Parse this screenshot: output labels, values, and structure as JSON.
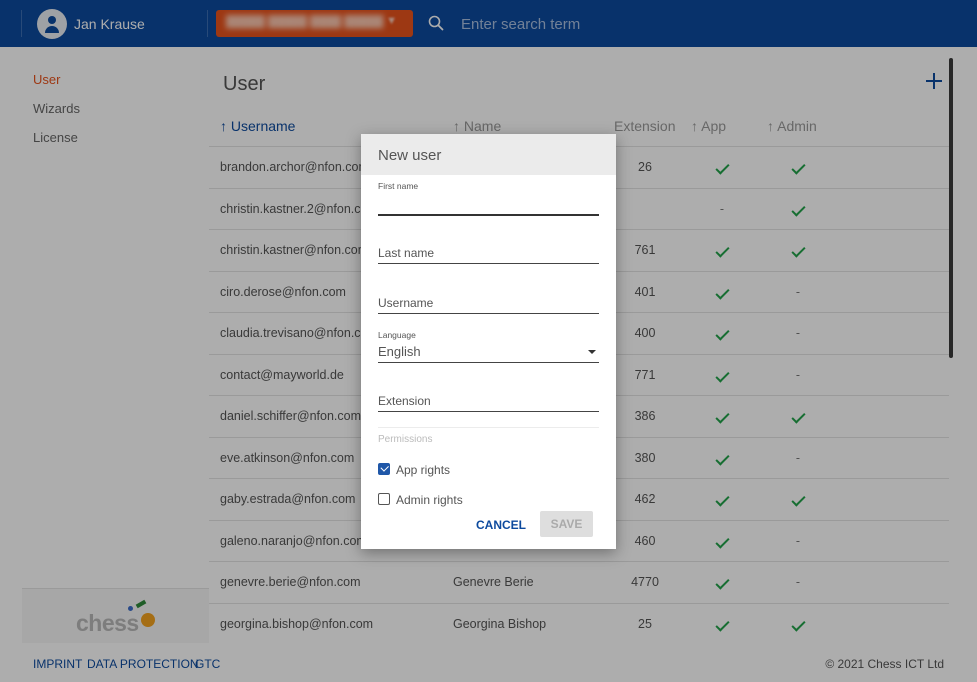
{
  "header": {
    "user_name": "Jan Krause",
    "account_selector": "█████ █████ ████ █████",
    "search_placeholder": "Enter search term",
    "icons": [
      "avatar-icon",
      "search-icon",
      "chevron-down-icon"
    ]
  },
  "sidebar": {
    "items": [
      {
        "label": "User",
        "active": true
      },
      {
        "label": "Wizards",
        "active": false
      },
      {
        "label": "License",
        "active": false
      }
    ],
    "logo_text": "chess"
  },
  "main": {
    "title": "User",
    "add_icon": "plus-icon",
    "columns": {
      "username": "↑ Username",
      "name": "↑ Name",
      "extension": "Extension",
      "app": "↑ App",
      "admin": "↑ Admin"
    },
    "rows": [
      {
        "username": "brandon.archor@nfon.com",
        "name": "",
        "extension": "26",
        "app": true,
        "admin": true
      },
      {
        "username": "christin.kastner.2@nfon.com",
        "name": "",
        "extension": "",
        "app": false,
        "admin": true
      },
      {
        "username": "christin.kastner@nfon.com",
        "name": "",
        "extension": "761",
        "app": true,
        "admin": true
      },
      {
        "username": "ciro.derose@nfon.com",
        "name": "",
        "extension": "401",
        "app": true,
        "admin": false
      },
      {
        "username": "claudia.trevisano@nfon.com",
        "name": "",
        "extension": "400",
        "app": true,
        "admin": false
      },
      {
        "username": "contact@mayworld.de",
        "name": "",
        "extension": "771",
        "app": true,
        "admin": false
      },
      {
        "username": "daniel.schiffer@nfon.com",
        "name": "",
        "extension": "386",
        "app": true,
        "admin": true
      },
      {
        "username": "eve.atkinson@nfon.com",
        "name": "",
        "extension": "380",
        "app": true,
        "admin": false
      },
      {
        "username": "gaby.estrada@nfon.com",
        "name": "",
        "extension": "462",
        "app": true,
        "admin": true
      },
      {
        "username": "galeno.naranjo@nfon.com",
        "name": "",
        "extension": "460",
        "app": true,
        "admin": false
      },
      {
        "username": "genevre.berie@nfon.com",
        "name": "Genevre Berie",
        "extension": "4770",
        "app": true,
        "admin": false
      },
      {
        "username": "georgina.bishop@nfon.com",
        "name": "Georgina Bishop",
        "extension": "25",
        "app": true,
        "admin": true
      }
    ],
    "check_color": "#22a34a"
  },
  "footer": {
    "links": [
      "IMPRINT",
      "DATA PROTECTION",
      "GTC"
    ],
    "copyright": "© 2021 Chess ICT Ltd"
  },
  "dialog": {
    "title": "New user",
    "first_name_label": "First name",
    "first_name_value": "",
    "last_name_placeholder": "Last name",
    "username_placeholder": "Username",
    "language_label": "Language",
    "language_value": "English",
    "extension_placeholder": "Extension",
    "permissions_label": "Permissions",
    "app_rights_label": "App rights",
    "app_rights_checked": true,
    "admin_rights_label": "Admin rights",
    "admin_rights_checked": false,
    "cancel_label": "CANCEL",
    "save_label": "SAVE"
  },
  "colors": {
    "header_bg": "#0d4a9e",
    "accent_orange": "#e8531d",
    "link_blue": "#0d4a9e"
  }
}
